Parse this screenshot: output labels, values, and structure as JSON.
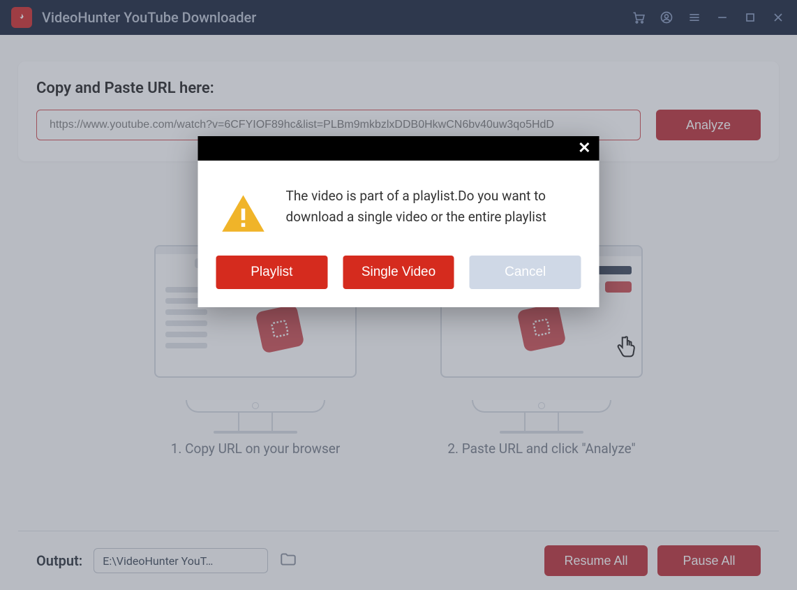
{
  "app": {
    "title": "VideoHunter YouTube Downloader"
  },
  "input": {
    "label": "Copy and Paste URL here:",
    "value": "https://www.youtube.com/watch?v=6CFYIOF89hc&list=PLBm9mkbzlxDDB0HkwCN6bv40uw3qo5HdD",
    "analyze": "Analyze"
  },
  "steps": {
    "one": "1. Copy URL on your browser",
    "two": "2. Paste URL and click \"Analyze\""
  },
  "output": {
    "label": "Output:",
    "path": "E:\\VideoHunter YouT…"
  },
  "footer": {
    "resume": "Resume All",
    "pause": "Pause All"
  },
  "dialog": {
    "message": "The video is part of a playlist.Do you want to download a single video or the entire playlist",
    "playlist": "Playlist",
    "single": "Single Video",
    "cancel": "Cancel"
  }
}
